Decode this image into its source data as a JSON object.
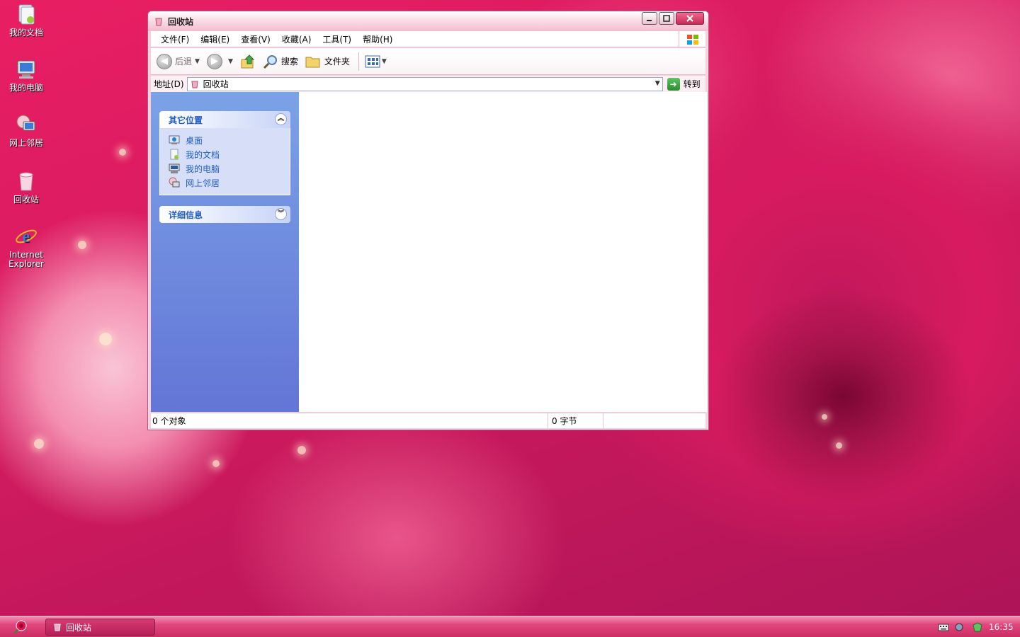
{
  "desktop": {
    "icons": [
      {
        "label": "我的文档"
      },
      {
        "label": "我的电脑"
      },
      {
        "label": "网上邻居"
      },
      {
        "label": "回收站"
      },
      {
        "label": "Internet Explorer"
      }
    ]
  },
  "window": {
    "title": "回收站",
    "menu": [
      "文件(F)",
      "编辑(E)",
      "查看(V)",
      "收藏(A)",
      "工具(T)",
      "帮助(H)"
    ],
    "toolbar": {
      "back": "后退",
      "search": "搜索",
      "folders": "文件夹"
    },
    "address": {
      "label": "地址(D)",
      "value": "回收站",
      "go": "转到"
    },
    "sidepane": {
      "other_places": {
        "title": "其它位置",
        "links": [
          "桌面",
          "我的文档",
          "我的电脑",
          "网上邻居"
        ]
      },
      "details": {
        "title": "详细信息"
      }
    },
    "status": {
      "objects": "0 个对象",
      "size": "0 字节"
    }
  },
  "taskbar": {
    "task": "回收站",
    "clock": "16:35"
  },
  "colors": {
    "accent": "#d81b60",
    "link": "#215dc6",
    "sidepane": "#6f8ce0"
  }
}
